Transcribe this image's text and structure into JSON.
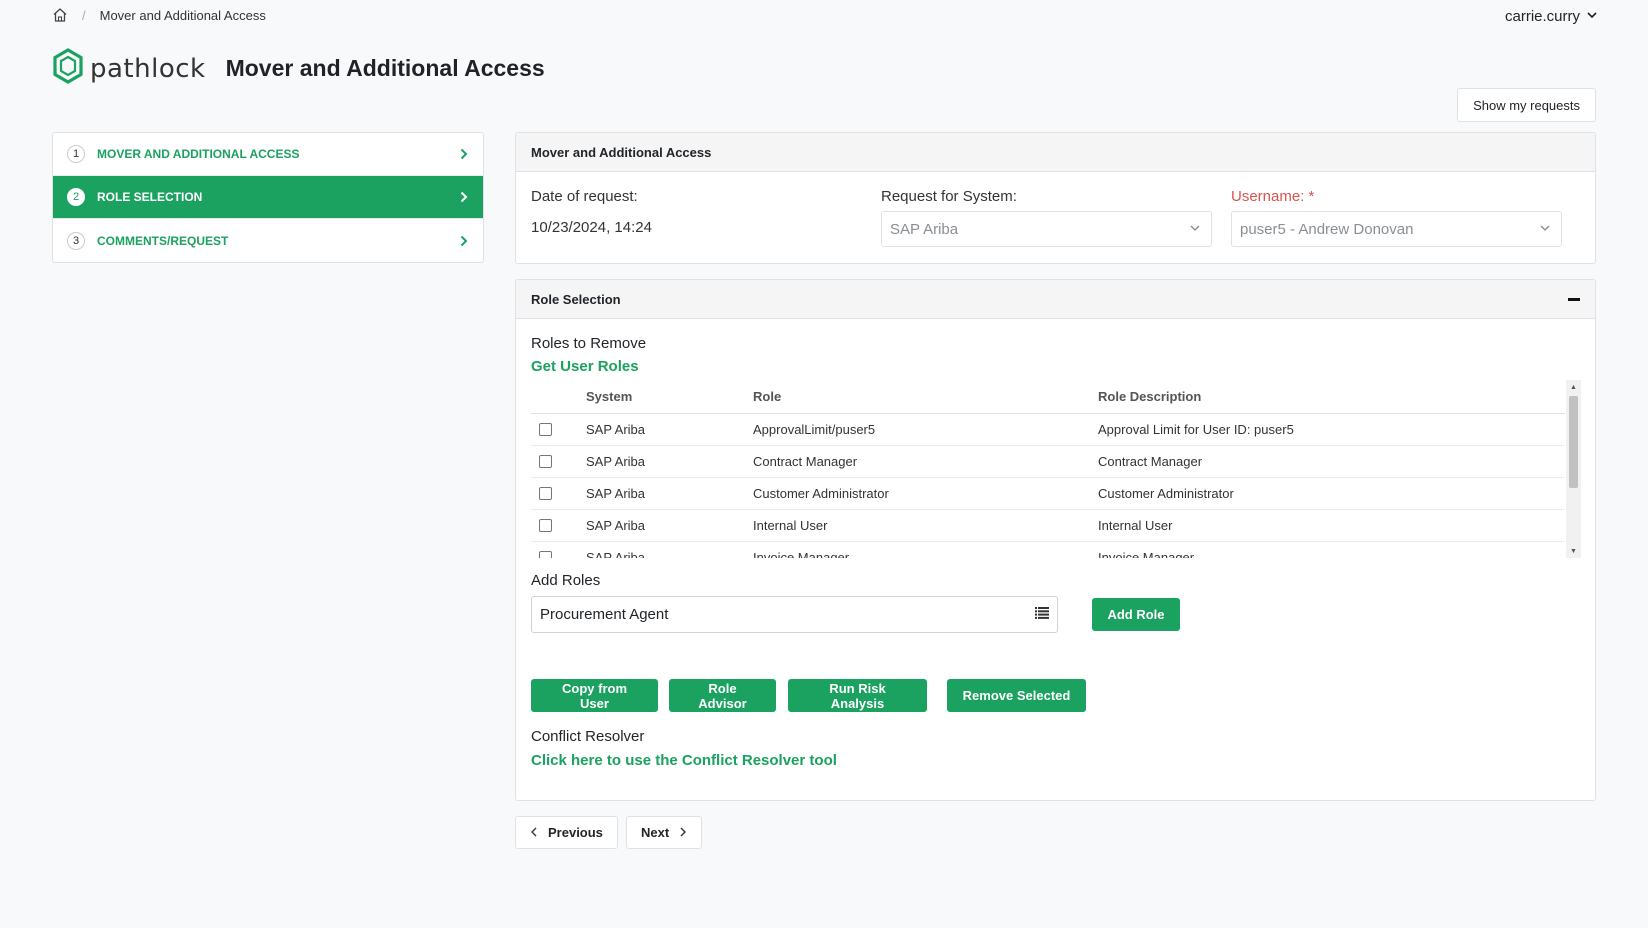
{
  "breadcrumb": {
    "current": "Mover and Additional Access"
  },
  "user": {
    "name": "carrie.curry"
  },
  "brand": {
    "logo_text": "pathlock",
    "page_title": "Mover and Additional Access",
    "accent": "#1ba160"
  },
  "header": {
    "show_requests_label": "Show my requests"
  },
  "steps": [
    {
      "num": "1",
      "label": "MOVER AND ADDITIONAL ACCESS",
      "active": false
    },
    {
      "num": "2",
      "label": "ROLE SELECTION",
      "active": true
    },
    {
      "num": "3",
      "label": "COMMENTS/REQUEST",
      "active": false
    }
  ],
  "request": {
    "card_title": "Mover and Additional Access",
    "date_label": "Date of request:",
    "date_value": "10/23/2024, 14:24",
    "system_label": "Request for System:",
    "system_value": "SAP Ariba",
    "username_label": "Username: *",
    "username_value": "puser5 - Andrew Donovan"
  },
  "role_selection": {
    "card_title": "Role Selection",
    "remove_title": "Roles to Remove",
    "get_roles_link": "Get User Roles",
    "columns": {
      "system": "System",
      "role": "Role",
      "description": "Role Description"
    },
    "rows": [
      {
        "system": "SAP Ariba",
        "role": "ApprovalLimit/puser5",
        "description": "Approval Limit for User ID: puser5"
      },
      {
        "system": "SAP Ariba",
        "role": "Contract Manager",
        "description": "Contract Manager"
      },
      {
        "system": "SAP Ariba",
        "role": "Customer Administrator",
        "description": "Customer Administrator"
      },
      {
        "system": "SAP Ariba",
        "role": "Internal User",
        "description": "Internal User"
      },
      {
        "system": "SAP Ariba",
        "role": "Invoice Manager",
        "description": "Invoice Manager"
      }
    ],
    "add_title": "Add Roles",
    "add_input_value": "Procurement Agent",
    "add_role_button": "Add Role",
    "actions": {
      "copy_from_user": "Copy from User",
      "role_advisor": "Role Advisor",
      "run_risk_analysis": "Run Risk Analysis",
      "remove_selected": "Remove Selected"
    },
    "conflict_title": "Conflict Resolver",
    "conflict_link": "Click here to use the Conflict Resolver tool"
  },
  "nav": {
    "previous": "Previous",
    "next": "Next"
  }
}
